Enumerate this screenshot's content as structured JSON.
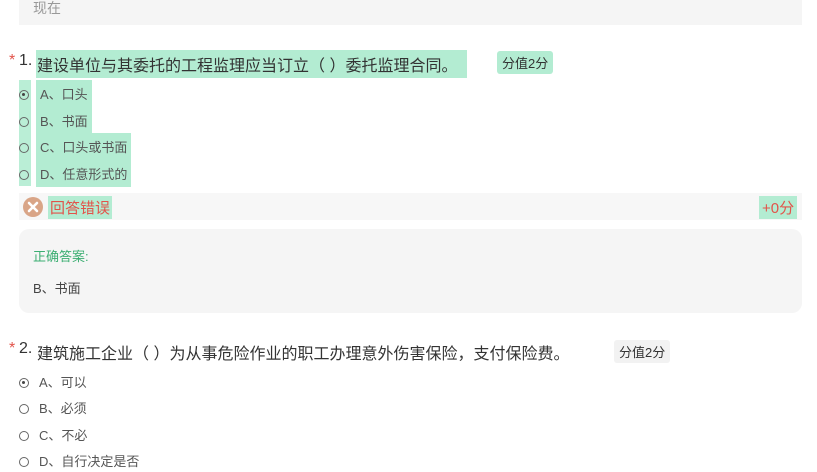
{
  "prev_answer": {
    "text": "现在"
  },
  "q1": {
    "required_mark": "*",
    "number": "1.",
    "title": "建设单位与其委托的工程监理应当订立（ ）委托监理合同。",
    "points": "分值2分",
    "options": [
      {
        "label": "A、口头",
        "selected": true
      },
      {
        "label": "B、书面",
        "selected": false
      },
      {
        "label": "C、口头或书面",
        "selected": false
      },
      {
        "label": "D、任意形式的",
        "selected": false
      }
    ],
    "result": {
      "icon": "wrong-icon",
      "text": "回答错误",
      "score": "+0分"
    },
    "correct": {
      "label": "正确答案:",
      "value": "B、书面"
    }
  },
  "q2": {
    "required_mark": "*",
    "number": "2.",
    "title": "建筑施工企业（ ）为从事危险作业的职工办理意外伤害保险，支付保险费。",
    "points": "分值2分",
    "options": [
      {
        "label": "A、可以",
        "selected": true
      },
      {
        "label": "B、必须",
        "selected": false
      },
      {
        "label": "C、不必",
        "selected": false
      },
      {
        "label": "D、自行决定是否",
        "selected": false
      }
    ]
  },
  "colors": {
    "highlight": "#b3ecd2",
    "error": "#e2534a",
    "correct_label": "#3cae72"
  }
}
